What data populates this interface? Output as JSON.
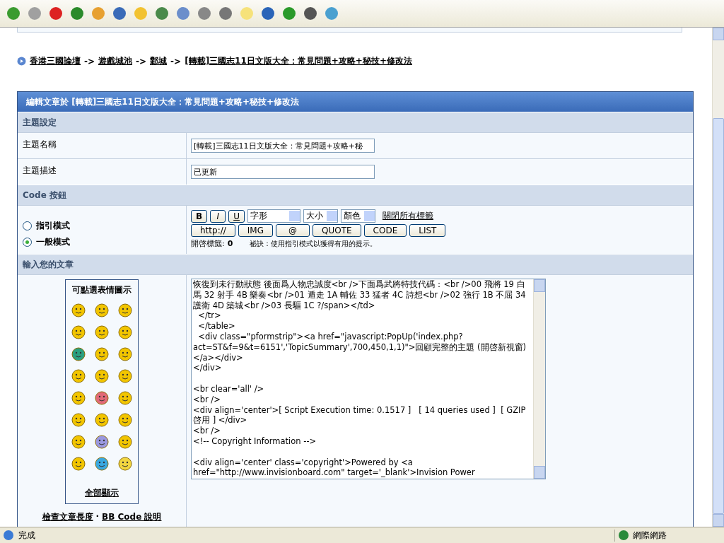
{
  "breadcrumb": [
    {
      "label": "香港三國論壇"
    },
    {
      "label": "遊戲城池"
    },
    {
      "label": "鄴城"
    },
    {
      "label": "[轉載]三國志11日文版大全：常見問題+攻略+秘技+修改法"
    }
  ],
  "breadcrumb_separator": "->",
  "form": {
    "title": "編輯文章於 [轉載]三國志11日文版大全：常見問題+攻略+秘技+修改法",
    "sections": [
      {
        "kind": "header",
        "label": "主題設定"
      },
      {
        "kind": "field",
        "label": "主題名稱",
        "value": "[轉載]三國志11日文版大全：常見問題+攻略+秘"
      },
      {
        "kind": "field",
        "label": "主題描述",
        "value": "已更新"
      },
      {
        "kind": "header",
        "label": "Code 按鈕"
      },
      {
        "kind": "code",
        "modes": [
          {
            "label": "指引模式",
            "selected": false
          },
          {
            "label": "一般模式",
            "selected": true
          }
        ],
        "format_buttons": [
          "B",
          "I",
          "U"
        ],
        "selects": [
          {
            "value": "字形"
          },
          {
            "value": "大小"
          },
          {
            "value": "顏色"
          }
        ],
        "close_all_link": "關閉所有標籤",
        "tag_buttons": [
          "http://",
          "IMG",
          "@",
          "QUOTE",
          "CODE",
          "LIST"
        ],
        "open_tags_label": "開啓標籤:",
        "open_tags_count": "0",
        "tip": "祕訣：使用指引模式以獲得有用的提示。"
      },
      {
        "kind": "header",
        "label": "輸入您的文章"
      },
      {
        "kind": "editor",
        "emoticons_title": "可點選表情圖示",
        "show_all": "全部顯示",
        "links": [
          "檢查文章長度",
          "BB Code 說明"
        ],
        "link_separator": "·",
        "text": "恢復到未行動狀態 後面爲人物忠誠度<br />下面爲武將特技代碼：<br />00 飛將 19 白馬 32 射手 4B 樂奏<br />01 遁走 1A 輔佐 33 猛者 4C 詩想<br />02 強行 1B 不屈 34 護衛 4D 築城<br />03 長驅 1C ?/span></td>\n  </tr>\n  </table>\n  <div class=\"pformstrip\"><a href=\"javascript:PopUp('index.php?act=ST&f=9&t=6151','TopicSummary',700,450,1,1)\">回顧完整的主題 (開啓新視窗)</a></div>\n</div>\n\n<br clear='all' />\n<br />\n<div align='center'>[ Script Execution time: 0.1517 ]   [ 14 queries used ]  [ GZIP 啓用 ] </div>\n<br />\n<!-- Copyright Information -->\n\n<div align='center' class='copyright'>Powered by <a href=\"http://www.invisionboard.com\" target='_blank'>Invision Power"
      }
    ]
  },
  "status_bar": {
    "text": "完成",
    "zone": "網際網路"
  }
}
